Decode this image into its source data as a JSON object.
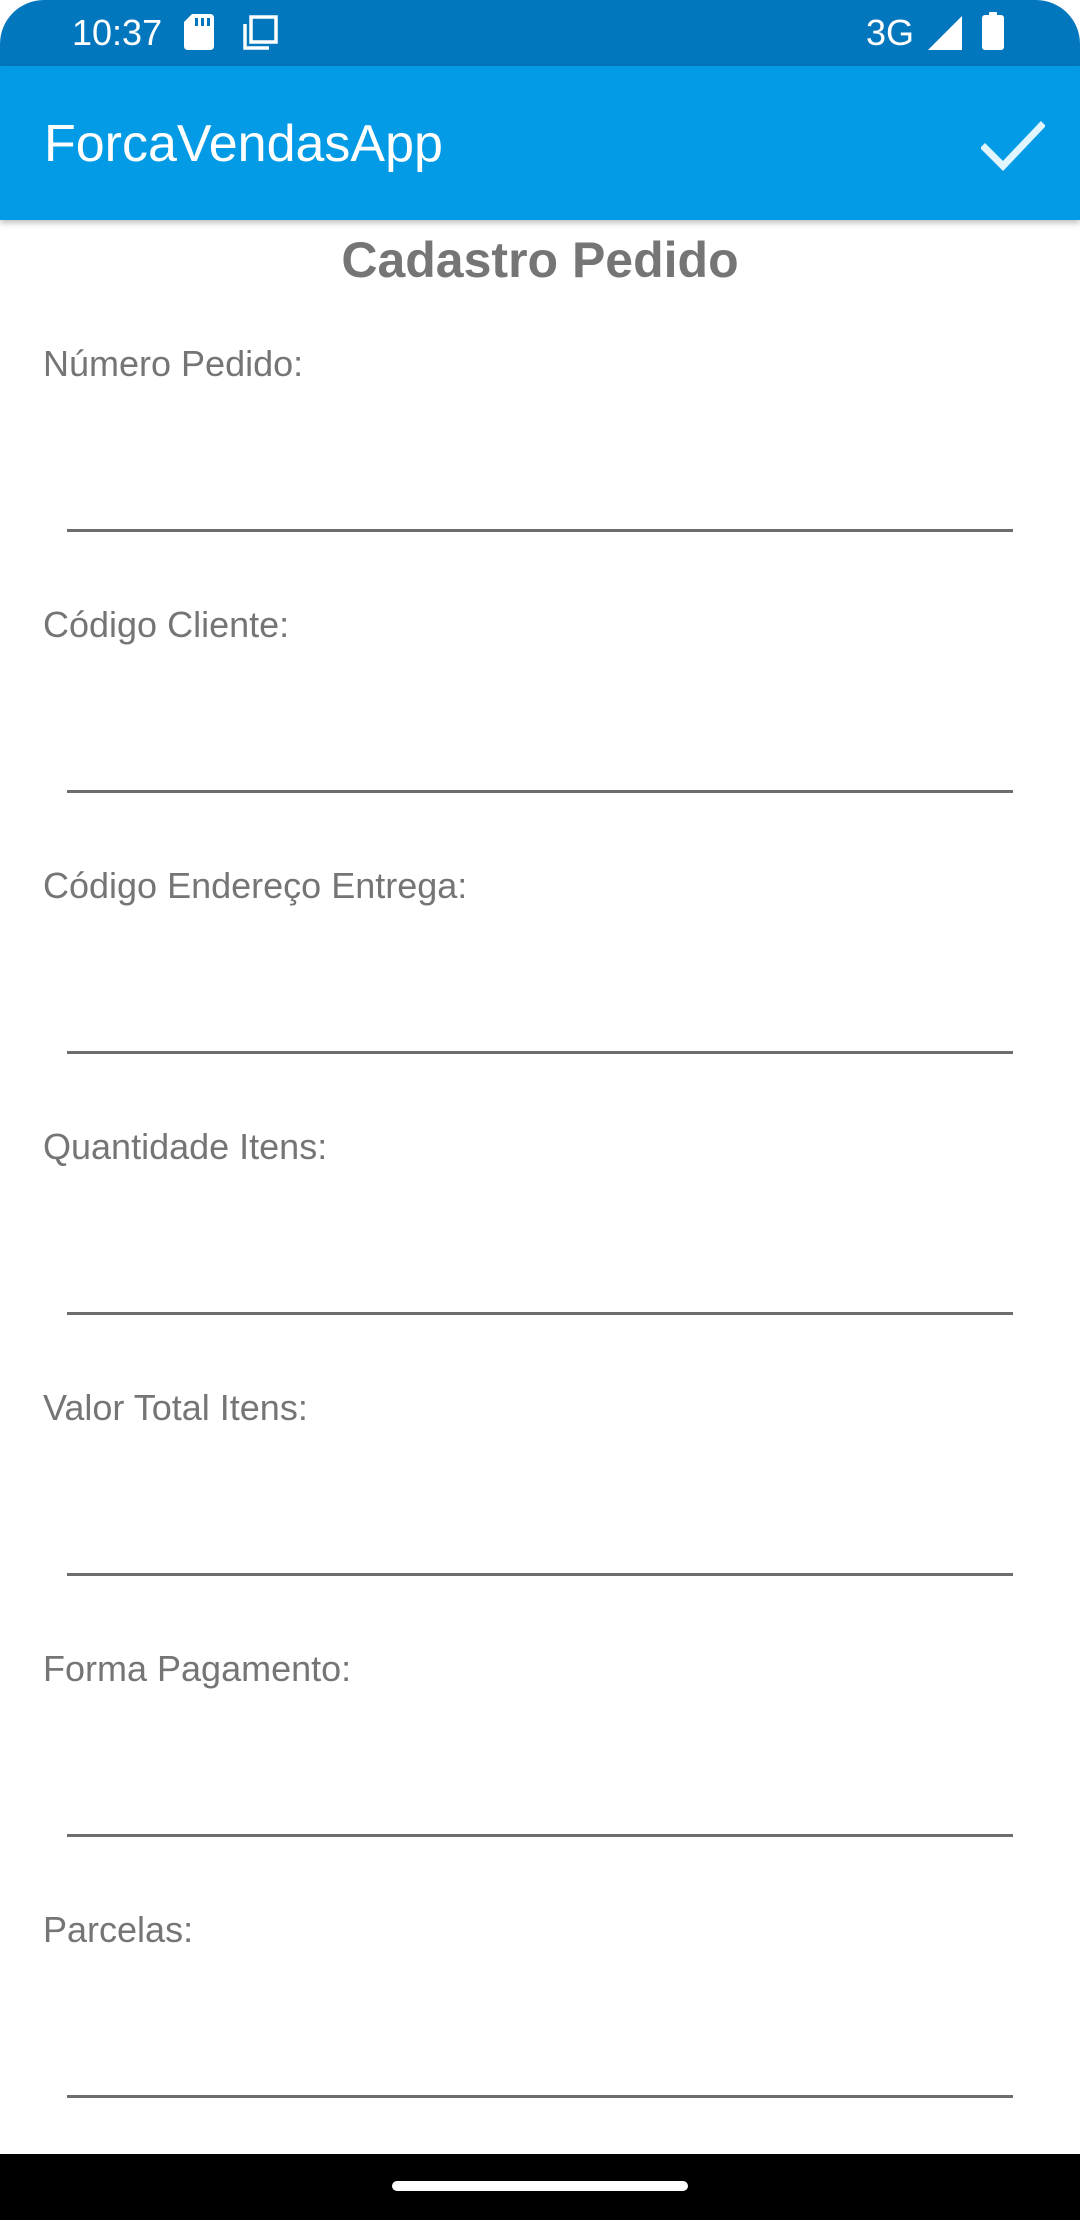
{
  "status_bar": {
    "time": "10:37",
    "network": "3G",
    "icons": [
      "sd-card-icon",
      "screen-copy-icon",
      "signal-icon",
      "battery-icon"
    ]
  },
  "app_bar": {
    "title": "ForcaVendasApp",
    "action_icon": "check-icon"
  },
  "form": {
    "title": "Cadastro Pedido",
    "fields": [
      {
        "label": "Número Pedido:",
        "value": ""
      },
      {
        "label": "Código Cliente:",
        "value": ""
      },
      {
        "label": "Código Endereço Entrega:",
        "value": ""
      },
      {
        "label": "Quantidade Itens:",
        "value": ""
      },
      {
        "label": "Valor Total Itens:",
        "value": ""
      },
      {
        "label": "Forma Pagamento:",
        "value": ""
      },
      {
        "label": "Parcelas:",
        "value": ""
      }
    ]
  },
  "colors": {
    "status_bar": "#0277bd",
    "app_bar": "#039be5",
    "label_text": "#757575",
    "underline": "#6d6d6d",
    "nav_bar": "#000000"
  }
}
